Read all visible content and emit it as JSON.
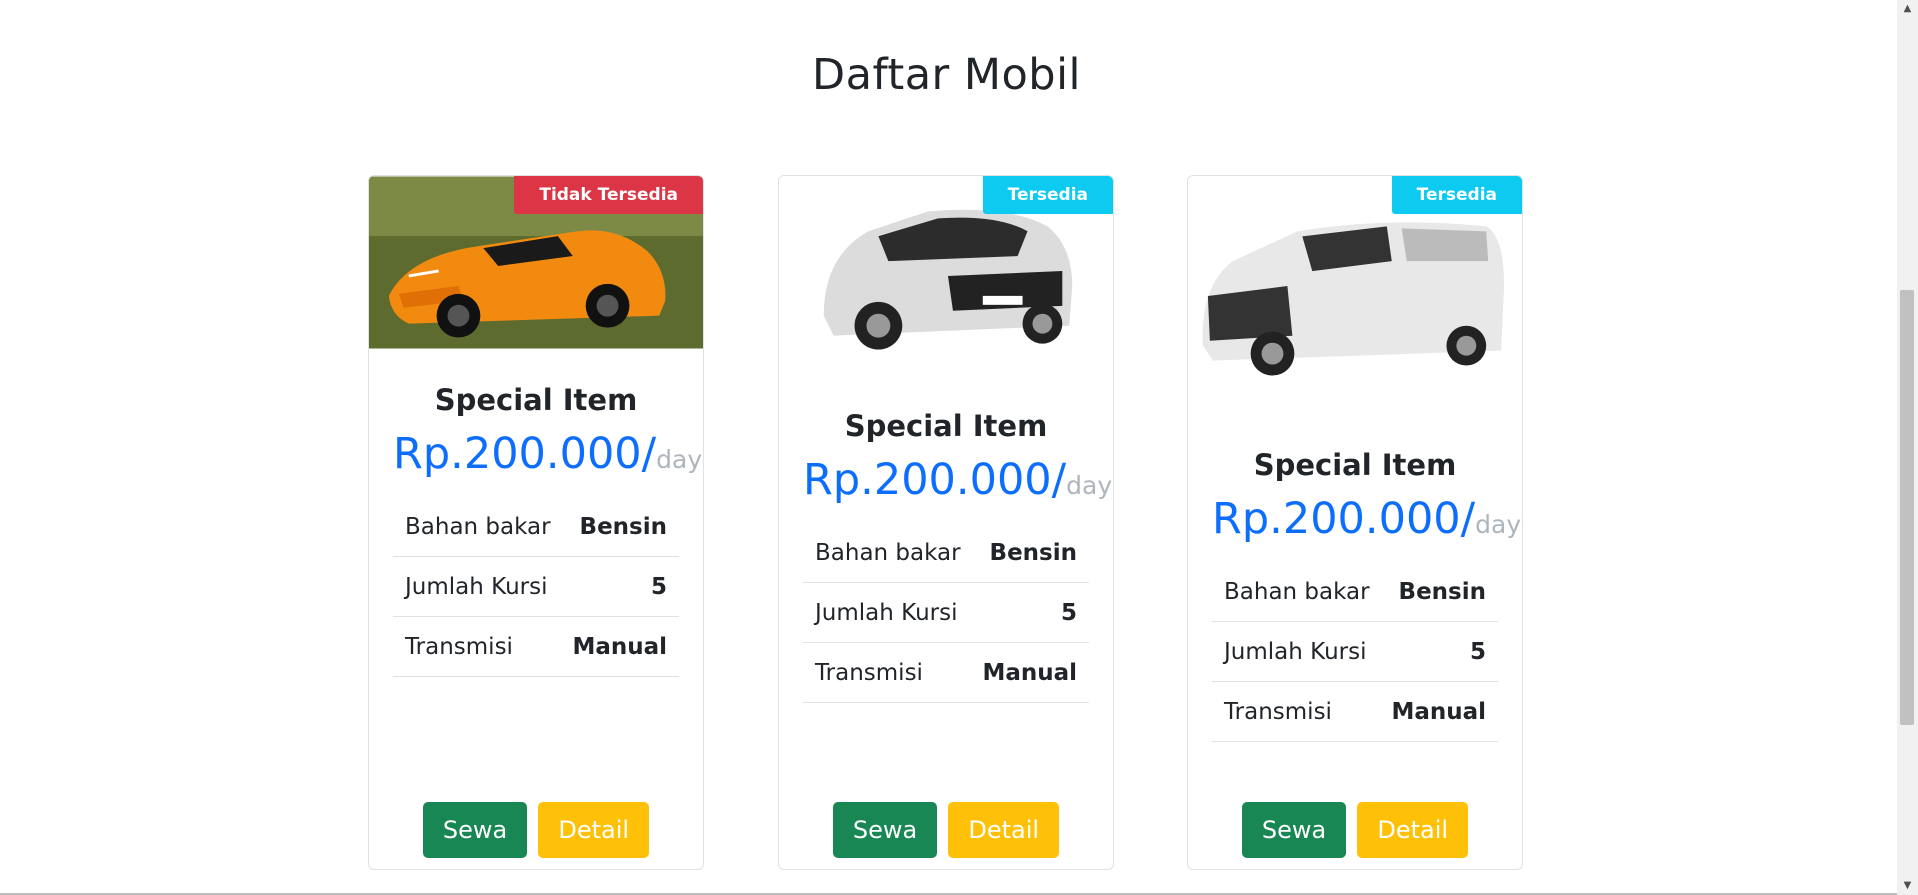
{
  "page": {
    "title": "Daftar Mobil"
  },
  "cars": [
    {
      "status": "Tidak Tersedia",
      "status_type": "unavailable",
      "name": "Special Item",
      "price": "Rp.200.000/",
      "unit": "day",
      "specs": [
        {
          "label": "Bahan bakar",
          "value": "Bensin"
        },
        {
          "label": "Jumlah Kursi",
          "value": "5"
        },
        {
          "label": "Transmisi",
          "value": "Manual"
        }
      ],
      "buttons": {
        "rent": "Sewa",
        "detail": "Detail"
      },
      "image": "orange-sports-car"
    },
    {
      "status": "Tersedia",
      "status_type": "available",
      "name": "Special Item",
      "price": "Rp.200.000/",
      "unit": "day",
      "specs": [
        {
          "label": "Bahan bakar",
          "value": "Bensin"
        },
        {
          "label": "Jumlah Kursi",
          "value": "5"
        },
        {
          "label": "Transmisi",
          "value": "Manual"
        }
      ],
      "buttons": {
        "rent": "Sewa",
        "detail": "Detail"
      },
      "image": "silver-mpv-avanza"
    },
    {
      "status": "Tersedia",
      "status_type": "available",
      "name": "Special Item",
      "price": "Rp.200.000/",
      "unit": "day",
      "specs": [
        {
          "label": "Bahan bakar",
          "value": "Bensin"
        },
        {
          "label": "Jumlah Kursi",
          "value": "5"
        },
        {
          "label": "Transmisi",
          "value": "Manual"
        }
      ],
      "buttons": {
        "rent": "Sewa",
        "detail": "Detail"
      },
      "image": "white-luxury-van-alphard"
    }
  ],
  "colors": {
    "price": "#0d6efd",
    "unavailable_badge": "#dc3545",
    "available_badge": "#0dcaf0",
    "rent_button": "#198754",
    "detail_button": "#ffc107"
  }
}
